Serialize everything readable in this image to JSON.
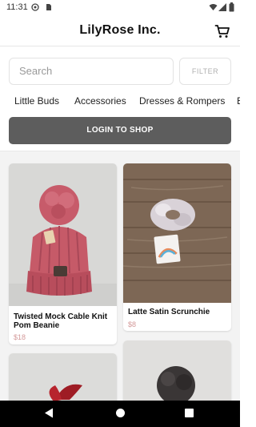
{
  "status_bar": {
    "time": "11:31",
    "icons": [
      "notification-icon",
      "sim-icon",
      "wifi-icon",
      "signal-icon",
      "battery-icon"
    ]
  },
  "header": {
    "title": "LilyRose Inc.",
    "cart_icon": "cart-icon"
  },
  "search": {
    "placeholder": "Search",
    "filter_label": "FILTER"
  },
  "categories": [
    "Little Buds",
    "Accessories",
    "Dresses & Rompers",
    "B"
  ],
  "login": {
    "label": "LOGIN TO SHOP"
  },
  "products": [
    {
      "name": "Twisted Mock Cable Knit Pom Beanie",
      "price": "$18"
    },
    {
      "name": "Latte  Satin Scrunchie",
      "price": "$8"
    },
    {
      "name": "",
      "price": ""
    },
    {
      "name": "",
      "price": ""
    }
  ],
  "colors": {
    "login_button": "#5d5d5d",
    "price": "#d49a9a",
    "grid_background": "#f3f3f3"
  },
  "nav_bar": {
    "icons": [
      "back-icon",
      "home-icon",
      "recents-icon"
    ]
  }
}
